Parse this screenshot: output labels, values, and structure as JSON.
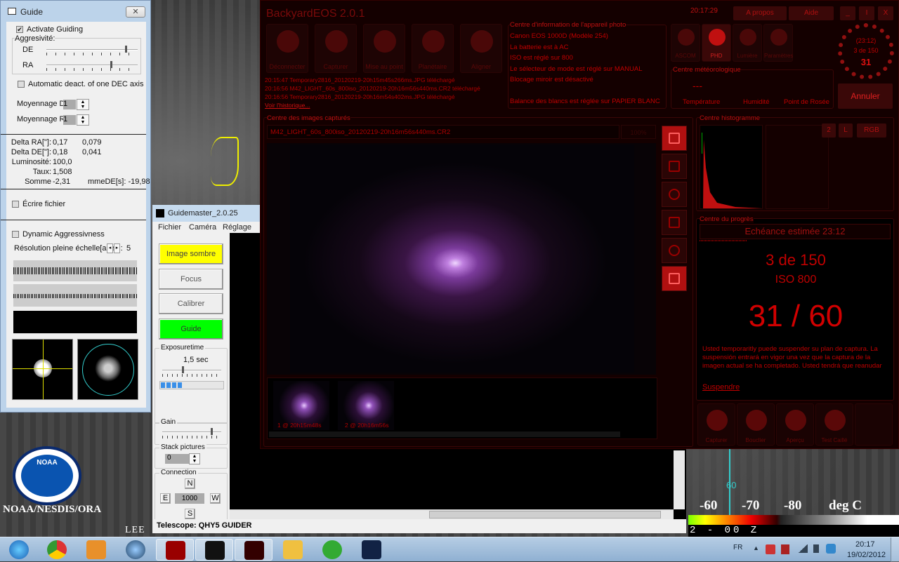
{
  "desktop": {
    "noaa_logo": "NOAA",
    "noaa_caption": "NOAA/NESDIS/ORA",
    "map_label": "LEE",
    "contour_label": "60",
    "scale_labels": [
      "-60",
      "-70",
      "-80",
      "deg C"
    ],
    "time_code": "2 - 00 Z"
  },
  "guide": {
    "title": "Guide",
    "activate_guiding": "Activate Guiding",
    "activate_checked": true,
    "aggressivity": "Aggresivité:",
    "de": "DE",
    "ra": "RA",
    "de_level": 0.88,
    "ra_level": 0.72,
    "auto_deact": "Automatic deact. of one DEC axis",
    "avg_de": "Moyennage DE",
    "avg_ra": "Moyennage RA",
    "avg_de_val": "1",
    "avg_ra_val": "1",
    "stats": [
      {
        "label": "Delta RA[\"]:",
        "v1": "0,17",
        "v2": "0,079"
      },
      {
        "label": "Delta DE[\"]:",
        "v1": "0,18",
        "v2": "0,041"
      },
      {
        "label": "Luminosité:",
        "v1": "100,0",
        "v2": ""
      },
      {
        "label": "Taux:",
        "v1": "1,508",
        "v2": ""
      },
      {
        "label": "Somme",
        "v1": "-2,31",
        "v2": "mmeDE[s]:  -19,98"
      }
    ],
    "write_file": "Écrire fichier",
    "dynamic": "Dynamic Aggressivness",
    "resolution": "Résolution pleine échelle[asec]:",
    "resolution_val": "5"
  },
  "guidemaster": {
    "title": "Guidemaster_2.0.25",
    "menu": [
      "Fichier",
      "Caméra",
      "Réglage"
    ],
    "buttons": {
      "dark": "Image sombre",
      "focus": "Focus",
      "calibrate": "Calibrer",
      "guide": "Guide"
    },
    "exposure_label": "Exposuretime",
    "exposure_value": "1,5 sec",
    "exposure_level": 0.35,
    "gain_label": "Gain",
    "gain_level": 0.85,
    "stack_label": "Stack pictures",
    "stack_value": "0",
    "connection_label": "Connection",
    "n": "N",
    "e": "E",
    "w": "W",
    "s": "S",
    "step": "1000",
    "status": "Telescope: QHY5 GUIDER",
    "accent_dark": "#ffff00",
    "accent_guide": "#00ff00"
  },
  "eos": {
    "title": "BackyardEOS 2.0.1",
    "clock": "20:17:29",
    "about": "A propos",
    "help": "Aide",
    "min": "_",
    "max": "I",
    "close": "X",
    "tools": [
      "Déconnecter",
      "Capturer",
      "Mise au point",
      "Planétaire",
      "Aligner"
    ],
    "log": [
      "20:15:47  Temporary2816_20120219-20h15m45s266ms.JPG téléchargé",
      "20:16:56  M42_LIGHT_60s_800iso_20120219-20h16m56s440ms.CR2 téléchargé",
      "20:16:56  Temporary2816_20120219-20h16m54s402ms.JPG téléchargé"
    ],
    "history_link": "Voir l'historique...",
    "camera_info": {
      "title": "Centre d'information de l'appareil photo",
      "lines": [
        "Canon EOS 1000D   (Modèle 254)",
        "La batterie est à AC",
        "ISO est réglé sur 800",
        "Le sélecteur de mode est réglé sur MANUAL",
        "Blocage miroir est désactivé",
        "",
        "Balance des blancs est réglée sur PAPIER BLANC"
      ]
    },
    "plugins": [
      "ASCOM",
      "PHD",
      "Lumière",
      "Paramètres"
    ],
    "weather": {
      "title": "Centre météorologique",
      "value": "---",
      "labels": [
        "Température",
        "Humidité",
        "Point de Rosée"
      ]
    },
    "dial": {
      "time": "(23:12)",
      "count": "3 de 150",
      "seconds": "31",
      "progress": 0.52
    },
    "cancel": "Annuler",
    "images": {
      "title": "Centre des images capturés",
      "filename": "M42_LIGHT_60s_800iso_20120219-20h16m56s440ms.CR2",
      "zoom": "100%",
      "thumbs": [
        "1 @ 20h15m48s",
        "2 @ 20h16m56s"
      ]
    },
    "histogram": {
      "title": "Centre histogramme",
      "buttons": [
        "2",
        "L",
        "RGB"
      ]
    },
    "progress": {
      "title": "Centre du progrès",
      "eta": "Echéance estimée 23:12",
      "count": "3 de 150",
      "iso": "ISO 800",
      "seconds": "31 / 60",
      "note": "Usted temporaritly puede suspender su plan de captura. La suspensión entrará en vigor una vez que la captura de la imagen actual se ha completado. Usted tendrá que reanudar",
      "suspend": "Suspendre"
    },
    "bottom_tools": [
      "Capturer",
      "Bouclier",
      "Aperçu",
      "Test Caillé"
    ],
    "accent": "#c00000"
  },
  "taskbar": {
    "lang": "FR",
    "time": "20:17",
    "date": "19/02/2012",
    "apps": [
      "start",
      "chrome",
      "media-player",
      "globe",
      "red-app",
      "guidemaster",
      "backyardeos",
      "explorer",
      "utorrent",
      "stellarium"
    ]
  }
}
